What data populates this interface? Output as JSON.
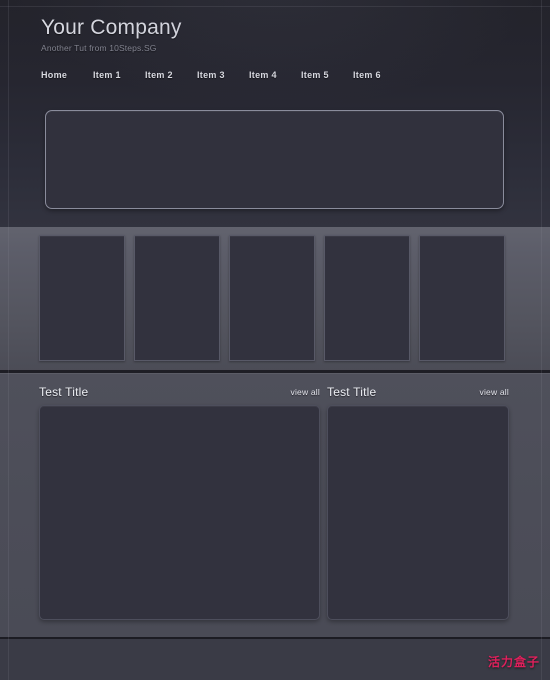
{
  "header": {
    "brand_title": "Your Company",
    "brand_subtitle": "Another Tut from 10Steps.SG",
    "nav": [
      {
        "label": "Home"
      },
      {
        "label": "Item 1"
      },
      {
        "label": "Item 2"
      },
      {
        "label": "Item 3"
      },
      {
        "label": "Item 4"
      },
      {
        "label": "Item 5"
      },
      {
        "label": "Item 6"
      }
    ]
  },
  "hero": {
    "name": "hero-banner"
  },
  "thumbnails": [
    {
      "name": "thumbnail-1"
    },
    {
      "name": "thumbnail-2"
    },
    {
      "name": "thumbnail-3"
    },
    {
      "name": "thumbnail-4"
    },
    {
      "name": "thumbnail-5"
    }
  ],
  "panels": [
    {
      "title": "Test Title",
      "view_all": "view all"
    },
    {
      "title": "Test Title",
      "view_all": "view all"
    }
  ],
  "footer": {
    "watermark": "活力盒子"
  },
  "colors": {
    "page_bg": "#2b2b33",
    "header_top": "#23232b",
    "header_bottom": "#32333f",
    "strip_bg": "#5c5d69",
    "main_bg": "#4c4d58",
    "box_fill": "#32323e",
    "hero_border": "#8a8c9c",
    "footer_bg": "#3a3b46",
    "watermark_color": "#e0205c",
    "title_text": "#d7d8e0",
    "sub_text": "#82838f"
  }
}
